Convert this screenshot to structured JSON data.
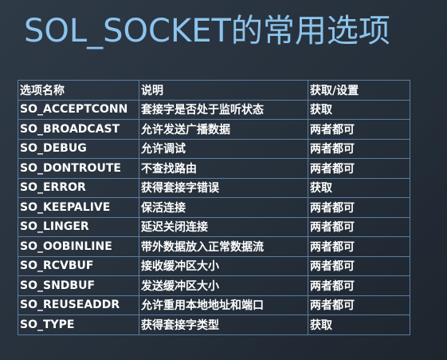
{
  "title": "SOL_SOCKET的常用选项",
  "table": {
    "headers": [
      "选项名称",
      "说明",
      "获取/设置"
    ],
    "rows": [
      [
        "SO_ACCEPTCONN",
        "套接字是否处于监听状态",
        "获取"
      ],
      [
        "SO_BROADCAST",
        "允许发送广播数据",
        "两者都可"
      ],
      [
        "SO_DEBUG",
        "允许调试",
        "两者都可"
      ],
      [
        "SO_DONTROUTE",
        "不查找路由",
        "两者都可"
      ],
      [
        "SO_ERROR",
        "获得套接字错误",
        "获取"
      ],
      [
        "SO_KEEPALIVE",
        "保活连接",
        "两者都可"
      ],
      [
        "SO_LINGER",
        "延迟关闭连接",
        "两者都可"
      ],
      [
        "SO_OOBINLINE",
        "带外数据放入正常数据流",
        "两者都可"
      ],
      [
        "SO_RCVBUF",
        "接收缓冲区大小",
        "两者都可"
      ],
      [
        "SO_SNDBUF",
        "发送缓冲区大小",
        "两者都可"
      ],
      [
        "SO_REUSEADDR",
        "允许重用本地地址和端口",
        "两者都可"
      ],
      [
        "SO_TYPE",
        "获得套接字类型",
        "获取"
      ]
    ]
  }
}
